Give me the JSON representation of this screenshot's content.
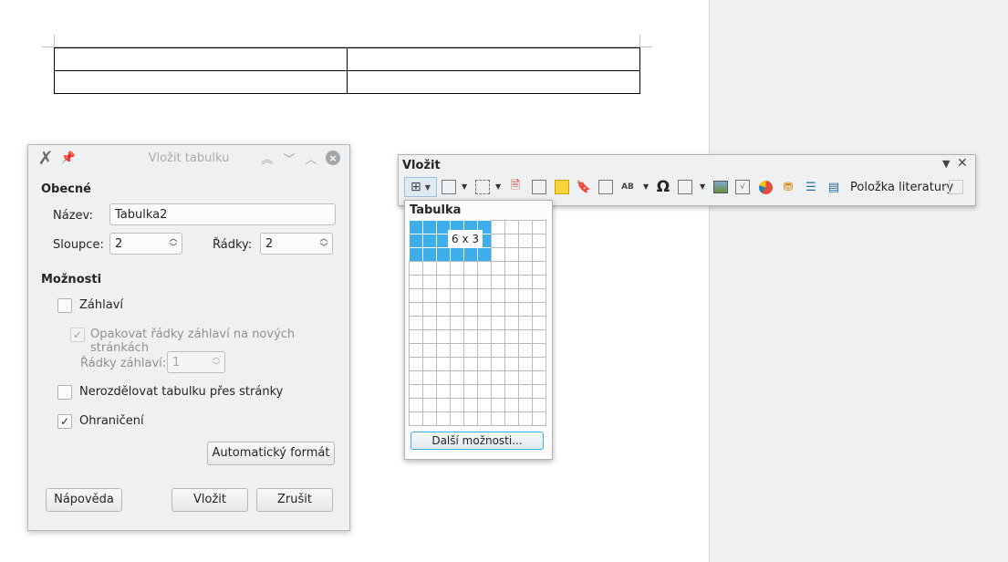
{
  "dialog": {
    "title": "Vložit tabulku",
    "general_heading": "Obecné",
    "name_label": "Název:",
    "name_value": "Tabulka2",
    "columns_label": "Sloupce:",
    "columns_value": "2",
    "rows_label": "Řádky:",
    "rows_value": "2",
    "options_heading": "Možnosti",
    "header_label": "Záhlaví",
    "header_checked": false,
    "repeat_header_label": "Opakovat řádky záhlaví na nových stránkách",
    "repeat_header_checked": true,
    "header_rows_label": "Řádky záhlaví:",
    "header_rows_value": "1",
    "dont_split_label": "Nerozdělovat tabulku přes stránky",
    "dont_split_checked": false,
    "border_label": "Ohraničení",
    "border_checked": true,
    "autoformat_button": "Automatický formát",
    "help_button": "Nápověda",
    "insert_button": "Vložit",
    "cancel_button": "Zrušit"
  },
  "toolbar": {
    "title": "Vložit",
    "bibliography_label": "Položka literatury"
  },
  "table_popup": {
    "title": "Tabulka",
    "size_label": "6 x 3",
    "selected_cols": 6,
    "selected_rows": 3,
    "grid_cols": 10,
    "grid_rows": 15,
    "more_options_button": "Další možnosti...",
    "highlight_color": "#3daee9"
  }
}
